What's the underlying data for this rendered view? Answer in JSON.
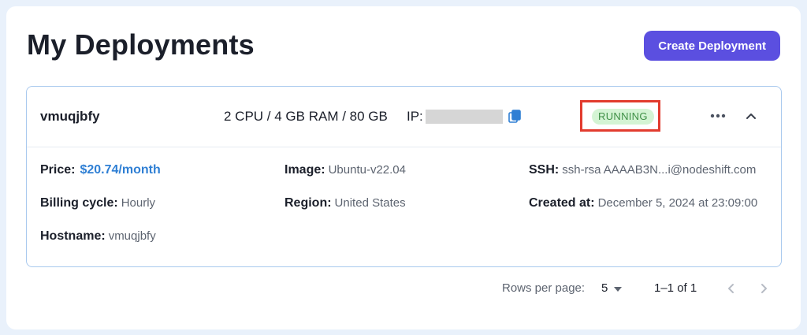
{
  "page": {
    "title": "My Deployments",
    "create_button_label": "Create Deployment"
  },
  "deployment": {
    "name": "vmuqjbfy",
    "specs": "2 CPU / 4 GB RAM / 80 GB",
    "ip_label": "IP:",
    "status": "RUNNING",
    "details": {
      "price_label": "Price:",
      "price_value": "$20.74/month",
      "billing_label": "Billing cycle:",
      "billing_value": "Hourly",
      "hostname_label": "Hostname:",
      "hostname_value": "vmuqjbfy",
      "image_label": "Image:",
      "image_value": "Ubuntu-v22.04",
      "region_label": "Region:",
      "region_value": "United States",
      "ssh_label": "SSH:",
      "ssh_value": "ssh-rsa AAAAB3N...i@nodeshift.com",
      "created_label": "Created at:",
      "created_value": "December 5, 2024 at 23:09:00"
    }
  },
  "pagination": {
    "rows_per_page_label": "Rows per page:",
    "rows_per_page_value": "5",
    "range": "1–1 of 1"
  },
  "icons": {
    "copy": "copy-icon",
    "more": "more-horizontal-icon",
    "collapse": "chevron-up-icon",
    "prev": "chevron-left-icon",
    "next": "chevron-right-icon"
  },
  "colors": {
    "accent": "#5b4fe0",
    "link": "#2f7fd4",
    "status_bg": "#d4f4d4",
    "status_text": "#3f8f46",
    "highlight_border": "#e23b2e"
  }
}
